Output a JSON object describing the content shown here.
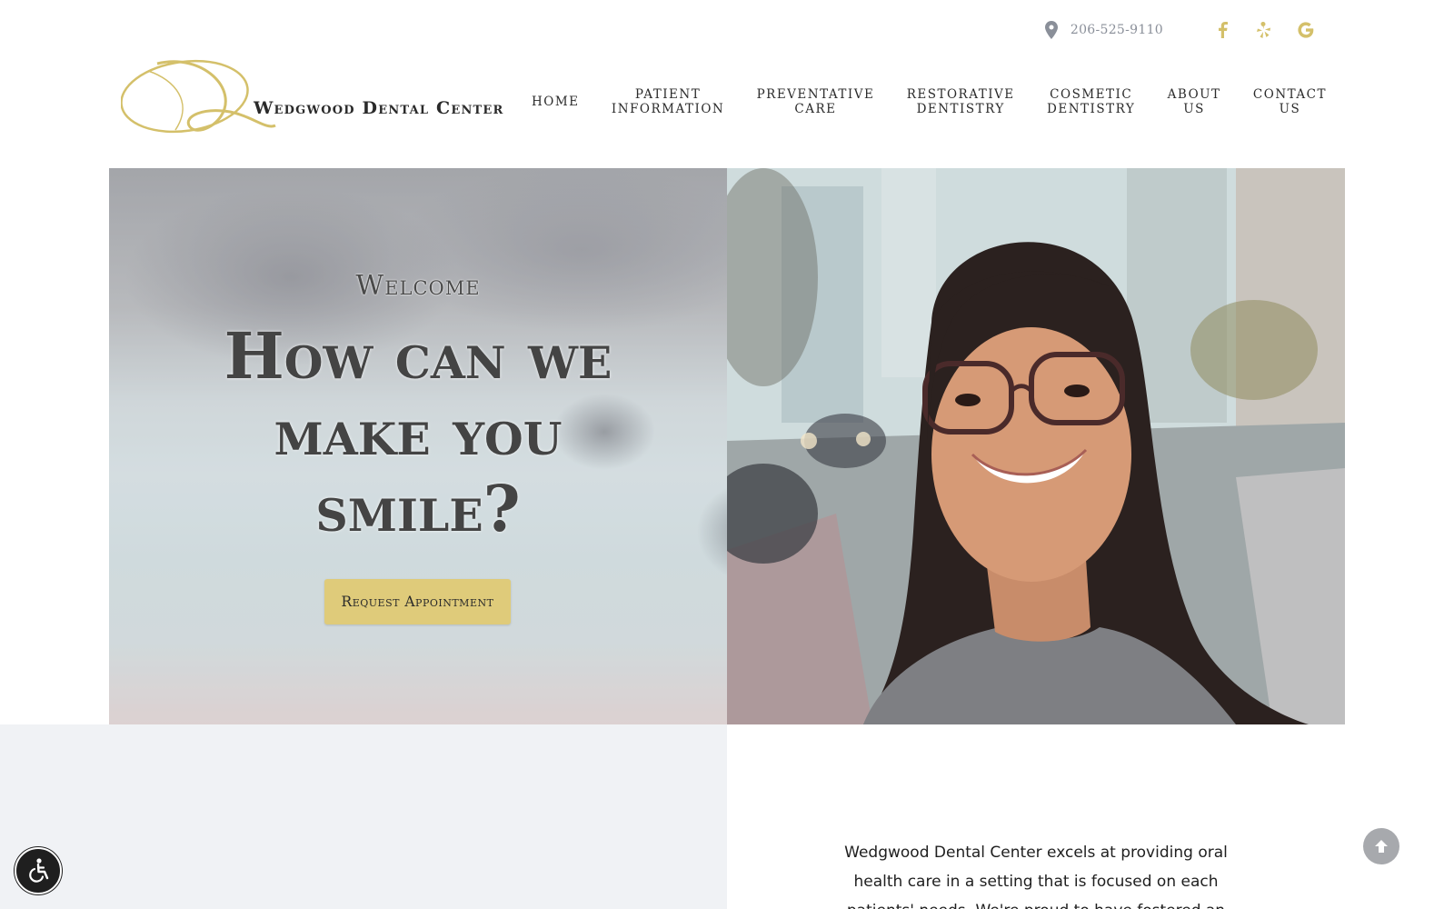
{
  "header": {
    "phone": "206-525-9110",
    "social": [
      {
        "name": "facebook-icon",
        "glyph": "f"
      },
      {
        "name": "yelp-icon",
        "glyph": "yelp"
      },
      {
        "name": "google-icon",
        "glyph": "G"
      }
    ],
    "accent_color": "#d4c06a",
    "logo_text": "Wedgwood Dental Center"
  },
  "nav": {
    "items": [
      {
        "line1": "HOME",
        "line2": ""
      },
      {
        "line1": "PATIENT",
        "line2": "INFORMATION"
      },
      {
        "line1": "PREVENTATIVE",
        "line2": "CARE"
      },
      {
        "line1": "RESTORATIVE",
        "line2": "DENTISTRY"
      },
      {
        "line1": "COSMETIC",
        "line2": "DENTISTRY"
      },
      {
        "line1": "ABOUT",
        "line2": "US"
      },
      {
        "line1": "CONTACT",
        "line2": "US"
      }
    ]
  },
  "hero": {
    "eyebrow": "Welcome",
    "headline": "How can we make you smile?",
    "cta_label": "Request Appointment",
    "cta_color": "#dfcb7a"
  },
  "intro": {
    "text": "Wedgwood Dental Center excels at providing oral health care in a setting that is focused on each patients' needs. We're proud to have fostered an"
  },
  "floating": {
    "accessibility_icon": "wheelchair-icon",
    "scroll_top_icon": "arrow-up-icon"
  }
}
